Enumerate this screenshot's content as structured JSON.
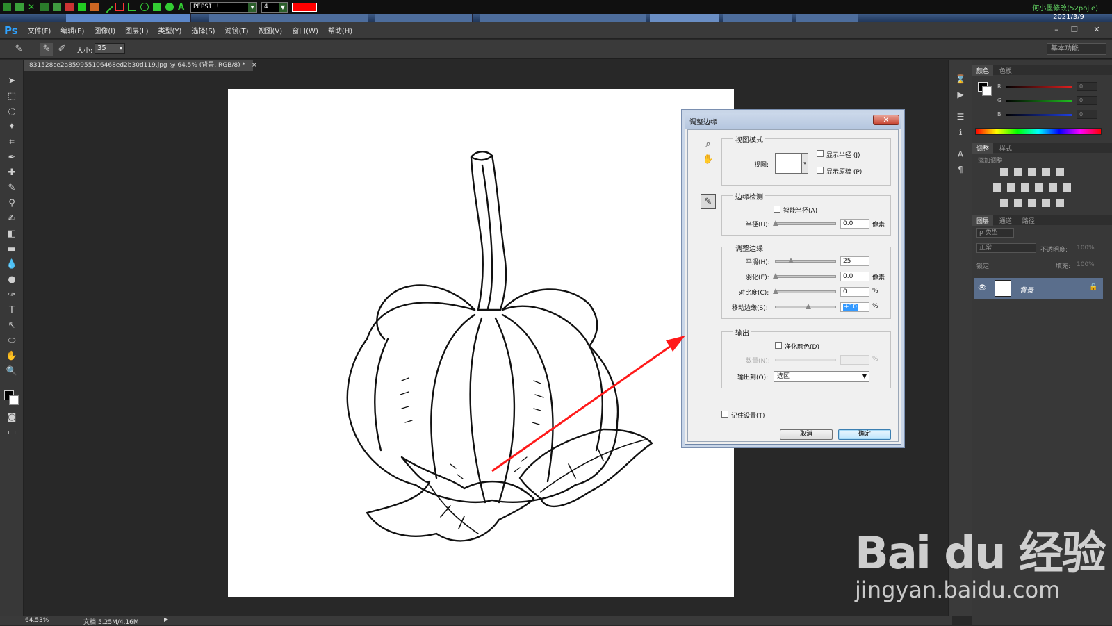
{
  "annotation_toolbar": {
    "font_value": "PEPSI !",
    "size_value": "4",
    "color": "#ff0000",
    "author_text": "何小墨修改(52pojie)"
  },
  "taskbar": {
    "date": "2021/3/9"
  },
  "menubar": {
    "logo": "Ps",
    "items": [
      "文件(F)",
      "编辑(E)",
      "图像(I)",
      "图层(L)",
      "类型(Y)",
      "选择(S)",
      "滤镜(T)",
      "视图(V)",
      "窗口(W)",
      "帮助(H)"
    ]
  },
  "options_bar": {
    "size_label": "大小:",
    "size_value": "35",
    "workspace": "基本功能"
  },
  "document": {
    "tab_title": "831528ce2a859955106468ed2b30d119.jpg @ 64.5% (背景, RGB/8) *",
    "tab_close": "×"
  },
  "status_bar": {
    "zoom": "64.53%",
    "doc_size": "文档:5.25M/4.16M"
  },
  "panels": {
    "color_tabs": [
      "颜色",
      "色板"
    ],
    "channels": [
      {
        "label": "R",
        "value": "0",
        "color": "#e02020"
      },
      {
        "label": "G",
        "value": "0",
        "color": "#20c020"
      },
      {
        "label": "B",
        "value": "0",
        "color": "#2040e0"
      }
    ],
    "adjust_tabs": [
      "调整",
      "样式"
    ],
    "adjust_title": "添加调整",
    "layer_tabs": [
      "图层",
      "通道",
      "路径"
    ],
    "layer_filter": "ρ 类型",
    "blend_mode": "正常",
    "opacity_label": "不透明度:",
    "opacity_value": "100%",
    "lock_label": "锁定:",
    "fill_label": "填充:",
    "fill_value": "100%",
    "layer_name": "背景"
  },
  "dialog": {
    "title": "调整边缘",
    "close": "✕",
    "view_mode": {
      "title": "视图模式",
      "view_label": "视图:",
      "show_radius": "显示半径 (J)",
      "show_original": "显示原稿 (P)"
    },
    "edge_detection": {
      "title": "边缘检测",
      "smart_radius": "智能半径(A)",
      "radius_label": "半径(U):",
      "radius_value": "0.0",
      "radius_unit": "像素",
      "radius_level": 0
    },
    "adjust_edge": {
      "title": "调整边缘",
      "smooth_label": "平滑(H):",
      "smooth_value": "25",
      "smooth_level": 0.25,
      "feather_label": "羽化(E):",
      "feather_value": "0.0",
      "feather_unit": "像素",
      "feather_level": 0,
      "contrast_label": "对比度(C):",
      "contrast_value": "0",
      "contrast_unit": "%",
      "contrast_level": 0,
      "shift_label": "移动边缘(S):",
      "shift_value": "+10",
      "shift_unit": "%",
      "shift_level": 0.55
    },
    "output": {
      "title": "输出",
      "decontaminate": "净化颜色(D)",
      "amount_label": "数量(N):",
      "amount_unit": "%",
      "output_to_label": "输出到(O):",
      "output_to_value": "选区"
    },
    "remember": "记住设置(T)",
    "cancel": "取消",
    "ok": "确定"
  },
  "watermark": {
    "logo": "Bai du 经验",
    "url": "jingyan.baidu.com"
  }
}
